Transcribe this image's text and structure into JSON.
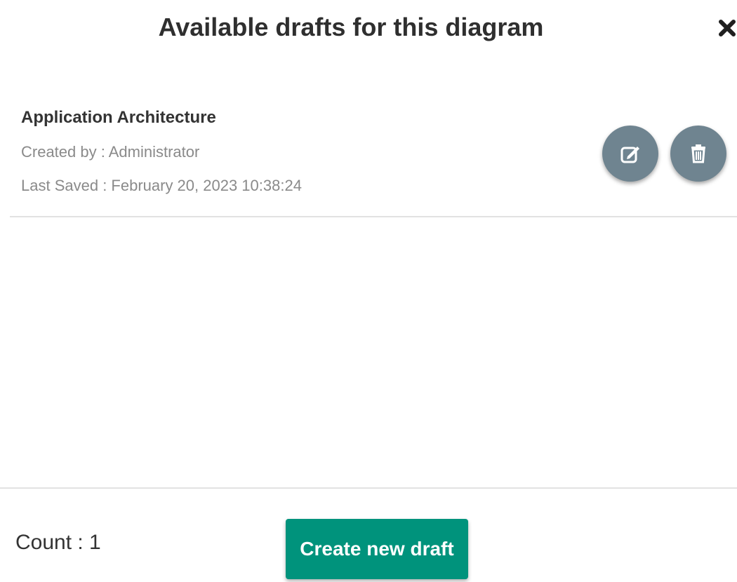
{
  "dialog": {
    "title": "Available drafts for this diagram",
    "close_icon": "close-icon"
  },
  "drafts": [
    {
      "name": "Application Architecture",
      "created_by": "Created by : Administrator",
      "last_saved": "Last Saved : February 20, 2023 10:38:24",
      "actions": [
        {
          "icon": "edit-icon"
        },
        {
          "icon": "trash-icon"
        }
      ]
    }
  ],
  "footer": {
    "count_text": "Count : 1",
    "create_button_label": "Create new draft"
  },
  "colors": {
    "action_button_bg": "#6f8490",
    "primary_button_bg": "#00937c",
    "title_text": "#2f2f2f",
    "meta_text": "#8a8a8a",
    "divider": "#e2e2e2"
  }
}
